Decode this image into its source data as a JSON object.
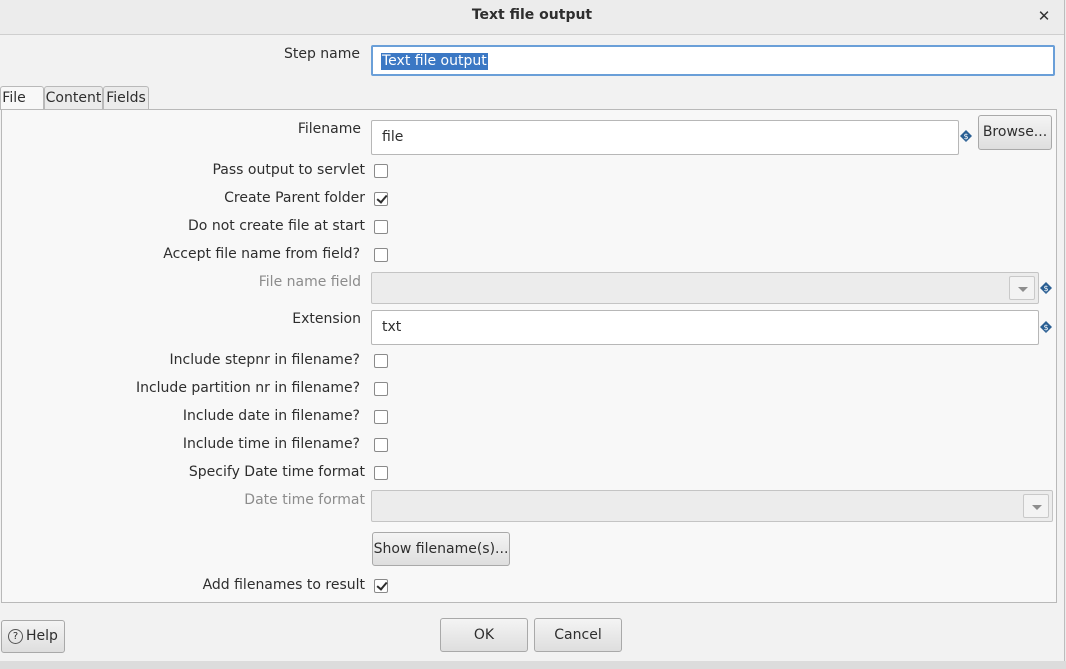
{
  "window": {
    "title": "Text file output",
    "close_glyph": "✕"
  },
  "step_name": {
    "label": "Step name",
    "value": "Text file output"
  },
  "tabs": [
    {
      "label": "File",
      "active": true
    },
    {
      "label": "Content",
      "active": false
    },
    {
      "label": "Fields",
      "active": false
    }
  ],
  "file_tab": {
    "filename": {
      "label": "Filename",
      "value": "file",
      "browse_label": "Browse..."
    },
    "pass_output_to_servlet": {
      "label": "Pass output to servlet",
      "checked": false
    },
    "create_parent_folder": {
      "label": "Create Parent folder",
      "checked": true
    },
    "do_not_create_file_at_start": {
      "label": "Do not create file at start",
      "checked": false
    },
    "accept_file_name_from_field": {
      "label": "Accept file name from field?",
      "checked": false
    },
    "file_name_field": {
      "label": "File name field",
      "value": ""
    },
    "extension": {
      "label": "Extension",
      "value": "txt"
    },
    "include_stepnr": {
      "label": "Include stepnr in filename?",
      "checked": false
    },
    "include_partition_nr": {
      "label": "Include partition nr in filename?",
      "checked": false
    },
    "include_date": {
      "label": "Include date in filename?",
      "checked": false
    },
    "include_time": {
      "label": "Include time in filename?",
      "checked": false
    },
    "specify_date_time_format": {
      "label": "Specify Date time format",
      "checked": false
    },
    "date_time_format": {
      "label": "Date time format",
      "value": ""
    },
    "show_filenames_label": "Show filename(s)...",
    "add_filenames_to_result": {
      "label": "Add filenames to result",
      "checked": true
    }
  },
  "footer": {
    "help_label": "Help",
    "ok_label": "OK",
    "cancel_label": "Cancel"
  },
  "colors": {
    "selection": "#3b78c4",
    "focus_border": "#6a9fd8",
    "variable_icon": "#2a5f93"
  }
}
